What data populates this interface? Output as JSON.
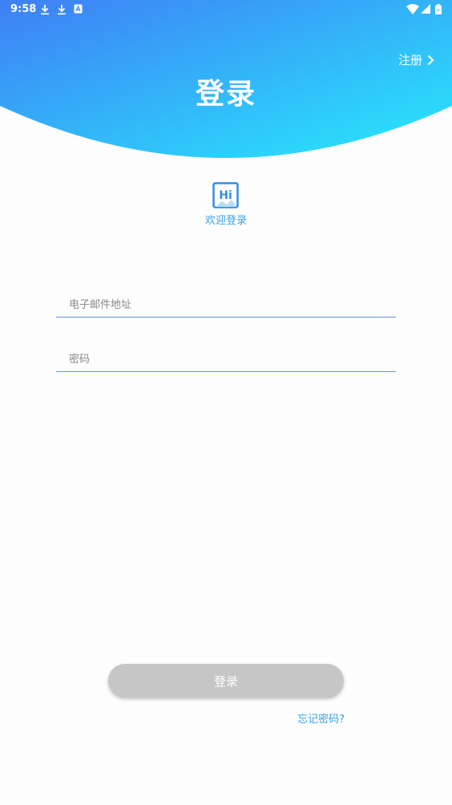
{
  "status_bar": {
    "time": "9:58",
    "left_icons": [
      "download-icon",
      "download-icon",
      "keyboard-icon"
    ],
    "right_icons": [
      "wifi-icon",
      "signal-icon",
      "battery-icon"
    ]
  },
  "header": {
    "title": "登录",
    "register_label": "注册",
    "register_icon": "chevron-right-icon",
    "gradient_start": "#3f7ef5",
    "gradient_end": "#27eafc"
  },
  "welcome": {
    "logo_text": "Hi",
    "text": "欢迎登录",
    "accent_color": "#3aa0e8"
  },
  "form": {
    "email_placeholder": "电子邮件地址",
    "password_placeholder": "密码",
    "login_label": "登录",
    "forgot_label": "忘记密码?"
  }
}
